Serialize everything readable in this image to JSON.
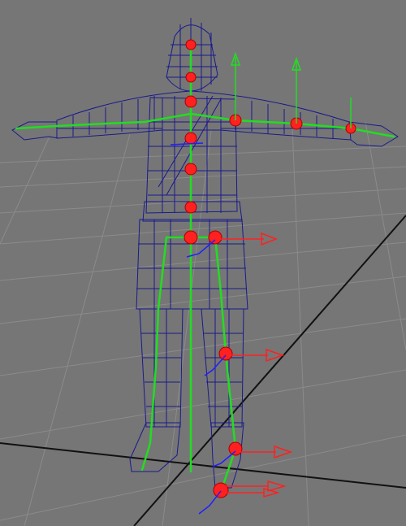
{
  "viewport": {
    "background": "#767676",
    "grid_color": "#8a8a8a",
    "axis_line_color": "#111111"
  },
  "model": {
    "wireframe_color": "#1a1a8c",
    "skeleton_color": "#22dd22",
    "joint_color": "#ff2020",
    "manipulator_x_color": "#ff2020",
    "manipulator_y_color": "#22dd22",
    "manipulator_z_color": "#2020ff"
  }
}
